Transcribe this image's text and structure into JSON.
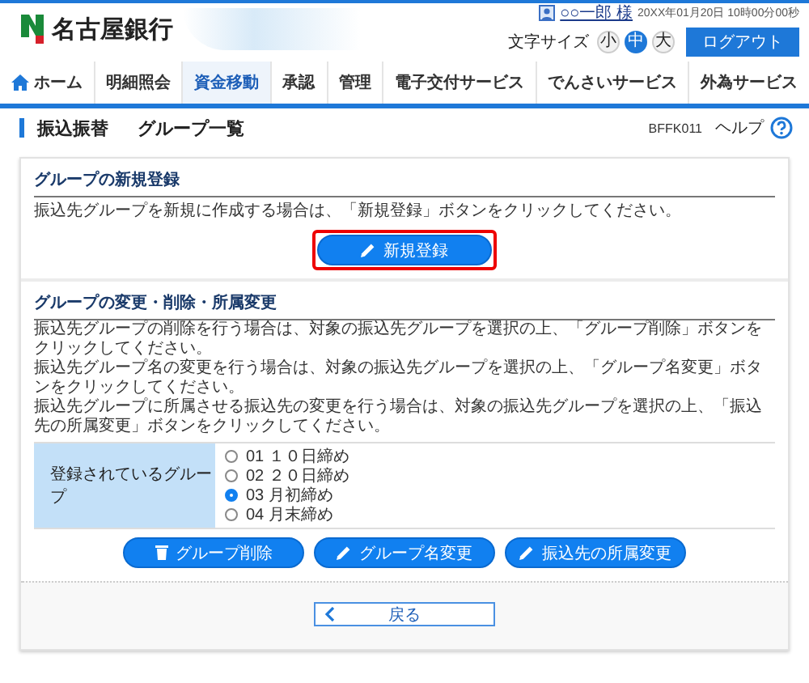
{
  "header": {
    "bank_name": "名古屋銀行",
    "user": "○○一郎 様",
    "datetime": "20XX年01月20日 10時00分00秒",
    "font_size_label": "文字サイズ",
    "font_sizes": [
      {
        "label": "小",
        "selected": false
      },
      {
        "label": "中",
        "selected": true
      },
      {
        "label": "大",
        "selected": false
      }
    ],
    "logout": "ログアウト"
  },
  "nav": [
    {
      "label": "ホーム",
      "kind": "home",
      "selected": false
    },
    {
      "label": "明細照会",
      "kind": "text",
      "selected": false
    },
    {
      "label": "資金移動",
      "kind": "text",
      "selected": true
    },
    {
      "label": "承認",
      "kind": "text",
      "selected": false
    },
    {
      "label": "管理",
      "kind": "text",
      "selected": false
    },
    {
      "label": "電子交付サービス",
      "kind": "text",
      "selected": false
    },
    {
      "label": "でんさいサービス",
      "kind": "text",
      "selected": false
    },
    {
      "label": "外為サービス",
      "kind": "text",
      "selected": false
    }
  ],
  "page_title": {
    "category": "振込振替",
    "title": "グループ一覧",
    "screen_id": "BFFK011",
    "help": "ヘルプ"
  },
  "new_registration": {
    "heading": "グループの新規登録",
    "description": "振込先グループを新規に作成する場合は、「新規登録」ボタンをクリックしてください。",
    "button": {
      "label": "新規登録",
      "highlighted": true
    }
  },
  "group_change": {
    "heading": "グループの変更・削除・所属変更",
    "description": [
      "振込先グループの削除を行う場合は、対象の振込先グループを選択の上、「グループ削除」ボタンをクリックしてください。",
      "振込先グループ名の変更を行う場合は、対象の振込先グループを選択の上、「グループ名変更」ボタンをクリックしてください。",
      "振込先グループに所属させる振込先の変更を行う場合は、対象の振込先グループを選択の上、「振込先の所属変更」ボタンをクリックしてください。"
    ],
    "table_header": "登録されているグループ",
    "groups": [
      {
        "label": "01 １０日締め",
        "selected": false
      },
      {
        "label": "02 ２０日締め",
        "selected": false
      },
      {
        "label": "03 月初締め",
        "selected": true
      },
      {
        "label": "04 月末締め",
        "selected": false
      }
    ],
    "buttons": [
      {
        "label": "グループ削除",
        "kind": "trash"
      },
      {
        "label": "グループ名変更",
        "kind": "pencil"
      },
      {
        "label": "振込先の所属変更",
        "kind": "pencil"
      }
    ]
  },
  "back_button": "戻る"
}
